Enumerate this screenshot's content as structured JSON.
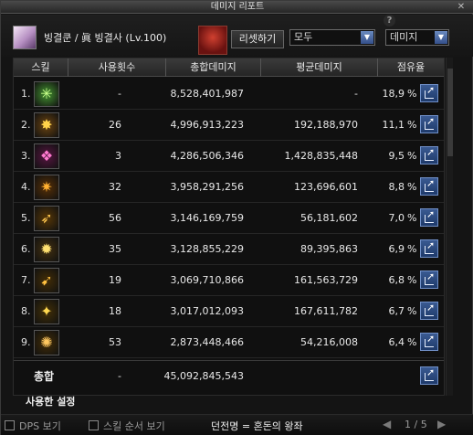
{
  "window": {
    "title": "데미지 리포트"
  },
  "header": {
    "character": "빙결쿤 / 眞 빙결사 (Lv.100)",
    "reset_label": "리셋하기",
    "filter_value": "모두",
    "type_value": "데미지",
    "help_glyph": "?",
    "close_glyph": "✕",
    "caret_glyph": "▼"
  },
  "columns": {
    "skill": "스킬",
    "count": "사용횟수",
    "total": "총합데미지",
    "avg": "평균데미지",
    "share": "점유율"
  },
  "rows": [
    {
      "rank": "1.",
      "count": "-",
      "total": "8,528,401,987",
      "avg": "-",
      "share": "18,9",
      "pct": "%",
      "icon": "green-star-burst-icon",
      "icon_glyph": "✳",
      "color": "#3a7a2a",
      "glyph_color": "#c8ff8a"
    },
    {
      "rank": "2.",
      "count": "26",
      "total": "4,996,913,223",
      "avg": "192,188,970",
      "share": "11,1",
      "pct": "%",
      "icon": "golden-burst-icon",
      "icon_glyph": "✸",
      "color": "#5a3a10",
      "glyph_color": "#ffd24a"
    },
    {
      "rank": "3.",
      "count": "3",
      "total": "4,286,506,346",
      "avg": "1,428,835,448",
      "share": "9,5",
      "pct": "%",
      "icon": "pink-diamond-grid-icon",
      "icon_glyph": "❖",
      "color": "#4a1438",
      "glyph_color": "#ff7ad0"
    },
    {
      "rank": "4.",
      "count": "32",
      "total": "3,958,291,256",
      "avg": "123,696,601",
      "share": "8,8",
      "pct": "%",
      "icon": "fire-spikes-icon",
      "icon_glyph": "✷",
      "color": "#4a2a08",
      "glyph_color": "#ffb030"
    },
    {
      "rank": "5.",
      "count": "56",
      "total": "3,146,169,759",
      "avg": "56,181,602",
      "share": "7,0",
      "pct": "%",
      "icon": "golden-bow-icon",
      "icon_glyph": "➶",
      "color": "#4a3008",
      "glyph_color": "#ffc850"
    },
    {
      "rank": "6.",
      "count": "35",
      "total": "3,128,855,229",
      "avg": "89,395,863",
      "share": "6,9",
      "pct": "%",
      "icon": "starburst-icon",
      "icon_glyph": "✹",
      "color": "#3a2a10",
      "glyph_color": "#ffe070"
    },
    {
      "rank": "7.",
      "count": "19",
      "total": "3,069,710,866",
      "avg": "161,563,729",
      "share": "6,8",
      "pct": "%",
      "icon": "golden-arrow-icon",
      "icon_glyph": "➹",
      "color": "#3a2808",
      "glyph_color": "#ffc040"
    },
    {
      "rank": "8.",
      "count": "18",
      "total": "3,017,012,093",
      "avg": "167,611,782",
      "share": "6,7",
      "pct": "%",
      "icon": "golden-crown-icon",
      "icon_glyph": "✦",
      "color": "#3a2a08",
      "glyph_color": "#ffd850"
    },
    {
      "rank": "9.",
      "count": "53",
      "total": "2,873,448,466",
      "avg": "54,216,008",
      "share": "6,4",
      "pct": "%",
      "icon": "golden-flare-icon",
      "icon_glyph": "✺",
      "color": "#3a2808",
      "glyph_color": "#ffc860"
    }
  ],
  "total": {
    "label": "총합",
    "count": "-",
    "total": "45,092,845,543"
  },
  "settings_label": "사용한 설정",
  "bottom": {
    "dps_label": "DPS 보기",
    "order_label": "스킬 순서 보기",
    "dungeon": "던전명 = 혼돈의 왕좌",
    "prev_glyph": "◀",
    "pager": "1 / 5",
    "next_glyph": "▶"
  },
  "colors": {
    "accent": "#3a5a92",
    "background": "#141414"
  }
}
